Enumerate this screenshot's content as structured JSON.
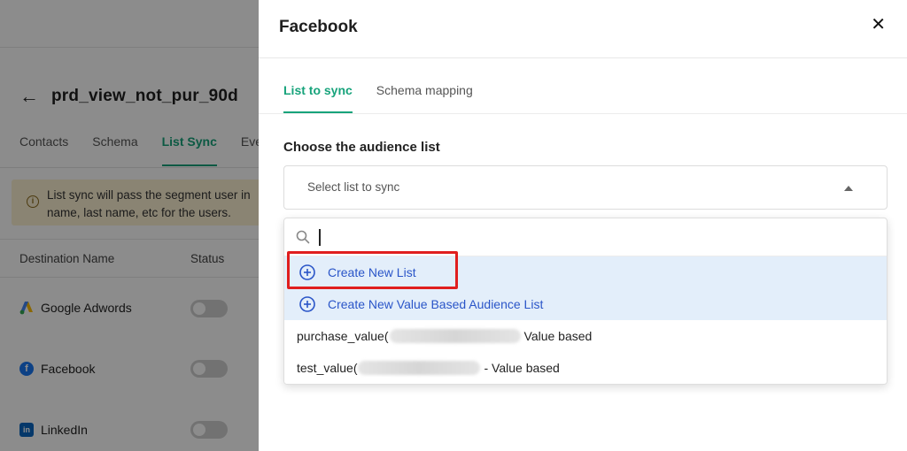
{
  "background": {
    "title": "prd_view_not_pur_90d",
    "tabs": [
      {
        "label": "Contacts",
        "active": false
      },
      {
        "label": "Schema",
        "active": false
      },
      {
        "label": "List Sync",
        "active": true
      },
      {
        "label": "Eve",
        "active": false
      }
    ],
    "info_line1": "List sync will pass the segment user in",
    "info_line2": "name, last name, etc for the users.",
    "table": {
      "col_destination": "Destination Name",
      "col_status": "Status",
      "rows": [
        {
          "name": "Google Adwords",
          "icon": "google-ads-icon",
          "enabled": false
        },
        {
          "name": "Facebook",
          "icon": "facebook-icon",
          "enabled": false
        },
        {
          "name": "LinkedIn",
          "icon": "linkedin-icon",
          "enabled": false
        }
      ]
    }
  },
  "panel": {
    "title": "Facebook",
    "close_icon": "close-icon",
    "tabs": [
      {
        "label": "List to sync",
        "active": true
      },
      {
        "label": "Schema mapping",
        "active": false
      }
    ],
    "section_label": "Choose the audience list",
    "select_placeholder": "Select list to sync",
    "search_value": "",
    "options": [
      {
        "label": "Create New List",
        "type": "action",
        "icon": "plus-circle-icon"
      },
      {
        "label": "Create New Value Based Audience List",
        "type": "action",
        "icon": "plus-circle-icon"
      },
      {
        "label_prefix": "purchase_value(",
        "label_suffix": "Value based",
        "type": "list"
      },
      {
        "label_prefix": "test_value(",
        "label_suffix": "- Value based",
        "type": "list"
      }
    ]
  },
  "colors": {
    "accent_green": "#17a37b",
    "action_blue": "#2a55c8",
    "action_bg": "#e3eefa",
    "highlight_red": "#e01e1e",
    "info_bg": "#fbf0d2"
  }
}
